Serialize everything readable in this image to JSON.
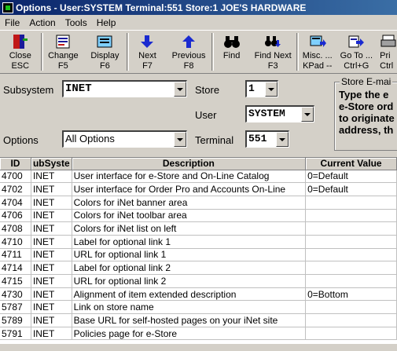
{
  "window": {
    "title": "Options - User:SYSTEM Terminal:551 Store:1 JOE'S HARDWARE"
  },
  "menu": [
    "File",
    "Action",
    "Tools",
    "Help"
  ],
  "toolbar": [
    {
      "icon": "close-door-icon",
      "line1": "Close",
      "line2": "ESC"
    },
    {
      "icon": "change-form-icon",
      "line1": "Change",
      "line2": "F5"
    },
    {
      "icon": "display-icon",
      "line1": "Display",
      "line2": "F6"
    },
    {
      "icon": "arrow-down-icon",
      "line1": "Next",
      "line2": "F7"
    },
    {
      "icon": "arrow-up-icon",
      "line1": "Previous",
      "line2": "F8"
    },
    {
      "icon": "binoculars-icon",
      "line1": "Find",
      "line2": ""
    },
    {
      "icon": "find-next-icon",
      "line1": "Find Next",
      "line2": "F3"
    },
    {
      "icon": "keypad-icon",
      "line1": "Misc. ...",
      "line2": "KPad --"
    },
    {
      "icon": "goto-icon",
      "line1": "Go To ...",
      "line2": "Ctrl+G"
    },
    {
      "icon": "printer-icon",
      "line1": "Pri",
      "line2": "Ctrl"
    }
  ],
  "filters": {
    "subsystem_label": "Subsystem",
    "subsystem_value": "INET",
    "options_label": "Options",
    "options_value": "All Options",
    "store_label": "Store",
    "store_value": "1",
    "user_label": "User",
    "user_value": "SYSTEM",
    "terminal_label": "Terminal",
    "terminal_value": "551"
  },
  "estore_panel": {
    "legend": "Store E-mai",
    "lines": [
      "Type the e",
      "e-Store ord",
      "to originate",
      "address, th"
    ]
  },
  "table": {
    "headers": [
      "ID",
      "ubSyste",
      "Description",
      "Current Value"
    ],
    "rows": [
      [
        "4700",
        "INET",
        "User interface for e-Store and On-Line Catalog",
        "0=Default"
      ],
      [
        "4702",
        "INET",
        "User interface for Order Pro and Accounts On-Line",
        "0=Default"
      ],
      [
        "4704",
        "INET",
        "Colors for iNet banner area",
        ""
      ],
      [
        "4706",
        "INET",
        "Colors for iNet toolbar area",
        ""
      ],
      [
        "4708",
        "INET",
        "Colors for iNet list on left",
        ""
      ],
      [
        "4710",
        "INET",
        "Label for optional link 1",
        ""
      ],
      [
        "4711",
        "INET",
        "URL for optional link 1",
        ""
      ],
      [
        "4714",
        "INET",
        "Label for optional link 2",
        ""
      ],
      [
        "4715",
        "INET",
        "URL for optional link 2",
        ""
      ],
      [
        "4730",
        "INET",
        "Alignment of item extended description",
        "0=Bottom"
      ],
      [
        "5787",
        "INET",
        "Link on store name",
        ""
      ],
      [
        "5789",
        "INET",
        "Base URL for self-hosted pages on your iNet site",
        ""
      ],
      [
        "5791",
        "INET",
        "Policies page for e-Store",
        ""
      ]
    ]
  }
}
